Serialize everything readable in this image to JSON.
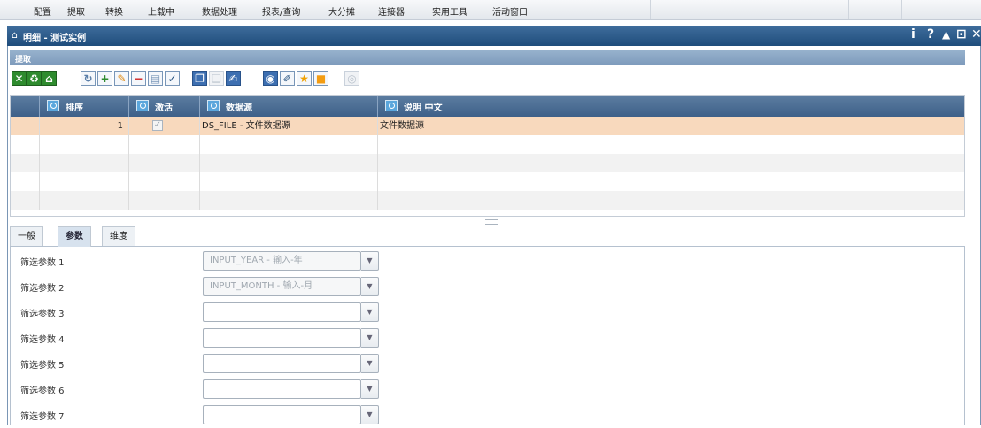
{
  "menu": [
    "配置",
    "提取",
    "转换",
    "上载中",
    "数据处理",
    "报表/查询",
    "大分摊",
    "连接器",
    "实用工具",
    "活动窗口"
  ],
  "window": {
    "title": "明细 - 测试实例",
    "buttons": {
      "info": "i",
      "help": "?",
      "collapse": "▲",
      "maximize": "⊡",
      "close": "✕"
    }
  },
  "section": {
    "title": "提取"
  },
  "toolbar": {
    "buttons": [
      {
        "name": "excel-export-icon",
        "glyph": "✕",
        "style": "green"
      },
      {
        "name": "recycle-icon",
        "glyph": "♻",
        "style": "green"
      },
      {
        "name": "home-upload-icon",
        "glyph": "⌂",
        "style": "green"
      },
      {
        "name": "refresh-icon",
        "glyph": "↻",
        "style": "plain"
      },
      {
        "name": "add-icon",
        "glyph": "+",
        "style": "plain"
      },
      {
        "name": "edit-pencil-icon",
        "glyph": "✎",
        "style": "plain"
      },
      {
        "name": "remove-icon",
        "glyph": "−",
        "style": "plain"
      },
      {
        "name": "save-disk-icon",
        "glyph": "▤",
        "style": "plain"
      },
      {
        "name": "confirm-check-icon",
        "glyph": "✓",
        "style": "plain"
      },
      {
        "name": "copy-icon",
        "glyph": "❐",
        "style": "blue"
      },
      {
        "name": "paste-icon",
        "glyph": "❑",
        "style": "dim"
      },
      {
        "name": "edit-document-icon",
        "glyph": "✍",
        "style": "blue"
      },
      {
        "name": "view-icon",
        "glyph": "◉",
        "style": "blue"
      },
      {
        "name": "tools-wrench-icon",
        "glyph": "✐",
        "style": "plain"
      },
      {
        "name": "favorite-star-icon",
        "glyph": "★",
        "style": "plain"
      },
      {
        "name": "orange-block-icon",
        "glyph": "■",
        "style": "plain"
      },
      {
        "name": "database-icon",
        "glyph": "◎",
        "style": "dim"
      }
    ]
  },
  "grid": {
    "columns": [
      "排序",
      "激活",
      "数据源",
      "说明 中文"
    ],
    "rows": [
      {
        "order": "1",
        "active": "✓",
        "source": "DS_FILE - 文件数据源",
        "desc": "文件数据源"
      }
    ]
  },
  "tabs": [
    "一般",
    "参数",
    "维度"
  ],
  "active_tab": "参数",
  "params": [
    {
      "label": "筛选参数 1",
      "value": "INPUT_YEAR - 输入-年"
    },
    {
      "label": "筛选参数 2",
      "value": "INPUT_MONTH - 输入-月"
    },
    {
      "label": "筛选参数 3",
      "value": ""
    },
    {
      "label": "筛选参数 4",
      "value": ""
    },
    {
      "label": "筛选参数 5",
      "value": ""
    },
    {
      "label": "筛选参数 6",
      "value": ""
    },
    {
      "label": "筛选参数 7",
      "value": ""
    }
  ],
  "dropdown_glyph": "▼"
}
